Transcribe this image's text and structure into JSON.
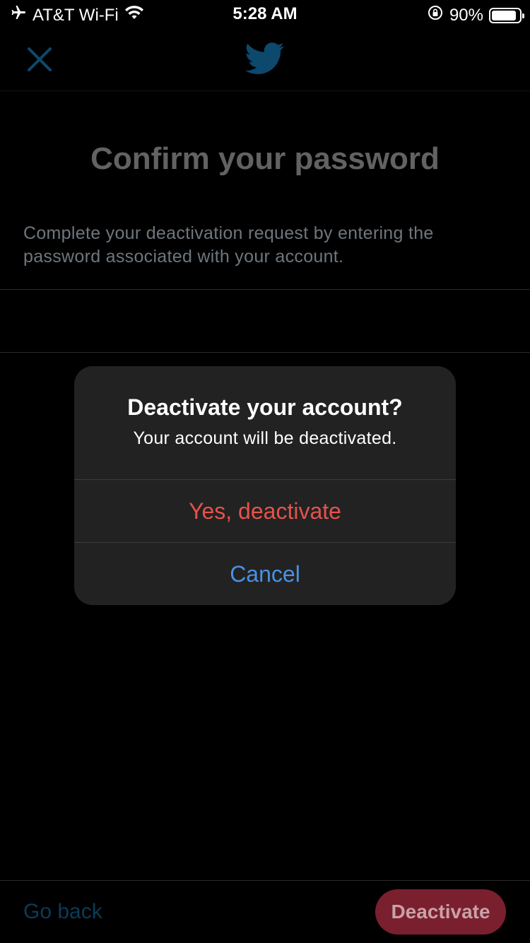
{
  "status_bar": {
    "carrier": "AT&T Wi-Fi",
    "time": "5:28 AM",
    "battery": "90%",
    "battery_level": 0.9,
    "icons": [
      "airplane-icon",
      "wifi-icon",
      "rotation-lock-icon",
      "battery-icon"
    ]
  },
  "nav": {
    "close_icon": "close-icon",
    "logo_icon": "twitter-bird-icon"
  },
  "page": {
    "title": "Confirm your password",
    "description": "Complete your deactivation request by entering the password associated with your account."
  },
  "dialog": {
    "title": "Deactivate your account?",
    "message": "Your account will be deactivated.",
    "confirm_label": "Yes, deactivate",
    "cancel_label": "Cancel"
  },
  "footer": {
    "back_label": "Go back",
    "deactivate_label": "Deactivate"
  },
  "colors": {
    "background": "#000000",
    "twitter_blue": "#1da1f2",
    "destructive": "#e5534b",
    "action_blue": "#4a90e2"
  }
}
